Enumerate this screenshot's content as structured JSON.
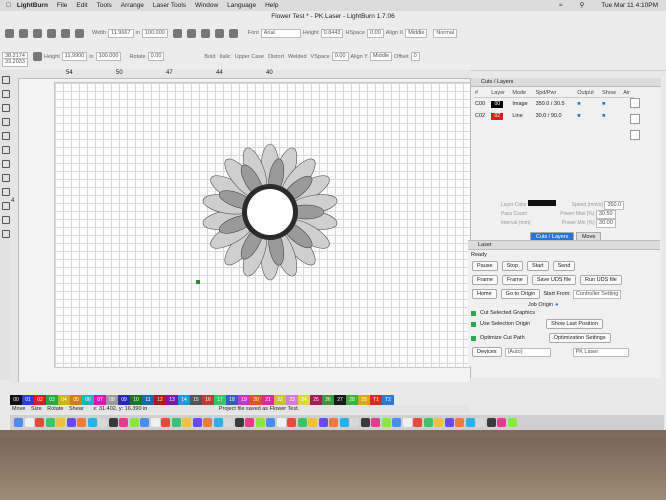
{
  "menubar": {
    "app": "LightBurn",
    "items": [
      "File",
      "Edit",
      "Tools",
      "Arrange",
      "Laser Tools",
      "Window",
      "Language",
      "Help"
    ],
    "clock": "Tue Mar 11 4:10PM"
  },
  "window_title": "Flower Test * - PK Laser - LightBurn 1.7.06",
  "toolbar": {
    "x_val": "38.2174",
    "y_val": "33.2033",
    "width_label": "Width",
    "width_val": "11.9667",
    "height_label": "Height",
    "height_val": "11.9900",
    "unit": "in",
    "w_pct": "100.000",
    "h_pct": "100.000",
    "rotate_label": "Rotate",
    "rotate_val": "0.00",
    "font_label": "Font",
    "font_val": "Arial",
    "text_height_label": "Height",
    "text_height_val": "0.8443",
    "hspace_label": "HSpace",
    "hspace_val": "0.00",
    "alignx_label": "Align X",
    "alignx_val": "Middle",
    "normal_val": "Normal",
    "vspace_label": "VSpace",
    "vspace_val": "0.00",
    "aligny_label": "Align Y",
    "aligny_val": "Middle",
    "offset_label": "Offset",
    "offset_val": "0",
    "bold": "Bold",
    "italic": "Italic",
    "upper_case": "Upper Case",
    "distort": "Distort",
    "welded": "Welded"
  },
  "ruler": {
    "top": [
      "54",
      "50",
      "47",
      "44",
      "40"
    ],
    "left": [
      "4"
    ]
  },
  "cuts_panel": {
    "title": "Cuts / Layers",
    "headers": [
      "#",
      "Layer",
      "Mode",
      "Spd/Pwr",
      "Output",
      "Show",
      "Air"
    ],
    "rows": [
      {
        "num": "C00",
        "layer": "00",
        "mode": "Image",
        "spdpwr": "350.0 / 30.5",
        "color": "#000000"
      },
      {
        "num": "C02",
        "layer": "02",
        "mode": "Line",
        "spdpwr": "30.0 / 90.0",
        "color": "#d81e1e"
      }
    ],
    "layer_color_label": "Layer Color",
    "speed_label": "Speed (mm/s)",
    "speed_val": "350.0",
    "pass_count_label": "Pass Count",
    "power_max_label": "Power Max (%)",
    "power_max_val": "30.50",
    "interval_label": "Interval (mm)",
    "power_min_label": "Power Min (%)",
    "power_min_val": "30.00"
  },
  "tabs": [
    "Cuts / Layers",
    "Move"
  ],
  "laser_panel": {
    "title": "Laser",
    "status": "Ready",
    "pause": "Pause",
    "stop": "Stop",
    "start": "Start",
    "send": "Send",
    "frame1": "Frame",
    "frame2": "Frame",
    "save_uds": "Save UDS file",
    "run_uds": "Run UDS file",
    "home": "Home",
    "go_origin": "Go to Origin",
    "start_from_label": "Start From:",
    "start_from_val": "Controller Setting",
    "job_origin": "Job Origin",
    "cut_selected": "Cut Selected Graphics",
    "use_selection_origin": "Use Selection Origin",
    "show_last_position": "Show Last Position",
    "optimize_cut": "Optimize Cut Path",
    "optimization_settings": "Optimization Settings",
    "devices": "Devices",
    "auto": "(Auto)",
    "device_name": "PK Laser"
  },
  "palette": [
    {
      "label": "00",
      "color": "#111111"
    },
    {
      "label": "01",
      "color": "#2a3fd6"
    },
    {
      "label": "02",
      "color": "#d81e1e"
    },
    {
      "label": "03",
      "color": "#27a745"
    },
    {
      "label": "04",
      "color": "#c9b21a"
    },
    {
      "label": "05",
      "color": "#d77a1a"
    },
    {
      "label": "06",
      "color": "#1ab4c9"
    },
    {
      "label": "07",
      "color": "#d31ab8"
    },
    {
      "label": "08",
      "color": "#9a9a9a"
    },
    {
      "label": "09",
      "color": "#2a2ab0"
    },
    {
      "label": "10",
      "color": "#1a7a1a"
    },
    {
      "label": "11",
      "color": "#1a6ab0"
    },
    {
      "label": "12",
      "color": "#b01a1a"
    },
    {
      "label": "13",
      "color": "#7a1ab0"
    },
    {
      "label": "14",
      "color": "#1a9ad8"
    },
    {
      "label": "15",
      "color": "#555555"
    },
    {
      "label": "16",
      "color": "#c43a3a"
    },
    {
      "label": "17",
      "color": "#3ac46a"
    },
    {
      "label": "18",
      "color": "#3a5ac4"
    },
    {
      "label": "19",
      "color": "#c43ac4"
    },
    {
      "label": "20",
      "color": "#d85a1a"
    },
    {
      "label": "21",
      "color": "#d82a9a"
    },
    {
      "label": "22",
      "color": "#c4c43a"
    },
    {
      "label": "23",
      "color": "#d87ad8"
    },
    {
      "label": "24",
      "color": "#d8d83a"
    },
    {
      "label": "25",
      "color": "#a81a5a"
    },
    {
      "label": "26",
      "color": "#3a9a3a"
    },
    {
      "label": "27",
      "color": "#1a1a1a"
    },
    {
      "label": "28",
      "color": "#3ab43a"
    },
    {
      "label": "29",
      "color": "#d8a81a"
    },
    {
      "label": "T1",
      "color": "#d82a2a"
    },
    {
      "label": "T2",
      "color": "#2a7ad8"
    }
  ],
  "status": {
    "move": "Move",
    "size": "Size",
    "rotate": "Rotate",
    "shear": "Shear",
    "coords": "x: 31.402, y: 16.390 in",
    "message": "Project file saved as Flower Test."
  }
}
